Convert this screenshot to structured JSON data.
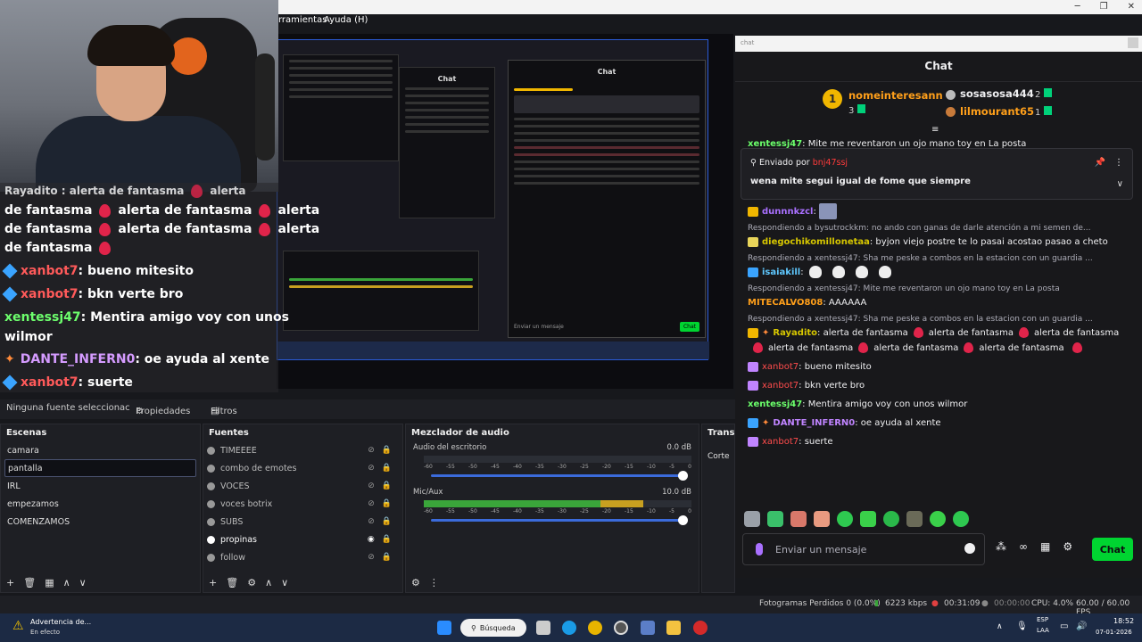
{
  "menu": {
    "herramientas": "rramientas",
    "ayuda": "Ayuda (H)"
  },
  "overlay": {
    "lines": [
      {
        "name": "",
        "text": "de fantasma",
        "text2": "alerta de fantasma",
        "text3": "alerta"
      },
      {
        "name": "",
        "text": "de fantasma",
        "text2": "alerta de fantasma",
        "text3": "alerta"
      },
      {
        "name": "",
        "text": "de fantasma"
      }
    ],
    "top_partial": "Rayadito : alerta de fantasma",
    "top_partial_tail": "alerta",
    "msg1_user": "xanbot7",
    "msg1_text": ": bueno mitesito",
    "msg2_user": "xanbot7",
    "msg2_text": ": bkn verte bro",
    "msg3_user": "xentessj47",
    "msg3_text": ": Mentira amigo voy con unos",
    "msg3_text2": "wilmor",
    "msg4_user": "DANTE_INFERN0",
    "msg4_text": ": oe ayuda al xente",
    "msg5_user": "xanbot7",
    "msg5_text": ": suerte"
  },
  "preview_mini": {
    "chat_title": "Chat",
    "send_placeholder": "Enviar un mensaje",
    "chat_btn": "Chat"
  },
  "props_bar": {
    "no_source": "Ninguna fuente seleccionac",
    "properties": "Propiedades",
    "filters": "Filtros"
  },
  "scenes": {
    "title": "Escenas",
    "items": [
      "camara",
      "pantalla",
      "IRL",
      "empezamos",
      "COMENZAMOS"
    ],
    "selected": "pantalla"
  },
  "sources": {
    "title": "Fuentes",
    "items": [
      "TIMEEEE",
      "combo de emotes",
      "VOCES",
      "voces botrix",
      "SUBS",
      "propinas",
      "follow"
    ]
  },
  "mixer": {
    "title": "Mezclador de audio",
    "tracks": [
      {
        "name": "Audio del escritorio",
        "db": "0.0 dB",
        "level": 0.0
      },
      {
        "name": "Mic/Aux",
        "db": "10.0 dB",
        "level": 0.82
      }
    ],
    "scale": [
      "-60",
      "-55",
      "-50",
      "-45",
      "-40",
      "-35",
      "-30",
      "-25",
      "-20",
      "-15",
      "-10",
      "-5",
      "0"
    ]
  },
  "transitions": {
    "title": "Transici",
    "mode": "Corte"
  },
  "status": {
    "dropped": "Fotogramas Perdidos 0 (0.0%)",
    "kbps": "6223 kbps",
    "live": "00:31:09",
    "rec": "00:00:00",
    "cpu": "CPU: 4.0%",
    "fps": "60.00 / 60.00 FPS"
  },
  "taskbar": {
    "warning_title": "Advertencia de...",
    "warning_sub": "En efecto",
    "search": "Búsqueda",
    "lang1": "ESP",
    "lang2": "LAA",
    "time": "18:52",
    "date": "07-01-2026"
  },
  "chatwin": {
    "window_title": "chat",
    "header": "Chat",
    "leader1_name": "nomeinteresann",
    "leader1_rank": "1",
    "leader1_count": "3",
    "leader2_name": "sosasosa444",
    "leader2_count": "2",
    "leader3_name": "lilmourant65",
    "leader3_count": "1",
    "cut_user": "xentessj47",
    "cut_text": ": Mite me reventaron un ojo mano toy en La posta",
    "pinned_by_label": "Enviado por",
    "pinned_by_user": "bnj47ssj",
    "pinned_msg": "wena mite segui igual de fome que siempre",
    "msgs": {
      "m1_user": "dunnnkzcl",
      "m1_text": ":",
      "r2": "Respondiendo a bysutrockkm: no ando con ganas de darle atención a mi semen de...",
      "m2_user": "diegochikomillonetaa",
      "m2_text": ": byjon viejo postre te lo pasai acostao pasao a cheto",
      "r3": "Respondiendo a xentessj47: Sha me peske a combos en la estacion con un guardia ...",
      "m3_user": "isaiakill",
      "m3_text": ":",
      "r4": "Respondiendo a xentessj47: Mite me reventaron un ojo mano toy en La posta",
      "m4_user": "MITECALVO808",
      "m4_text": ": AAAAAA",
      "r5": "Respondiendo a xentessj47: Sha me peske a combos en la estacion con un guardia ...",
      "m5_user": "Rayadito",
      "m5_text_a": ": alerta de fantasma",
      "m5_text_b": "alerta de fantasma",
      "m5_text_c": "alerta de",
      "m5_text_d": "fantasma",
      "m5_text_e": "alerta de fantasma",
      "m5_text_f": "alerta de fantasma",
      "m5_text_g": "alerta de fantasma",
      "m6_user": "xanbot7",
      "m6_text": ": bueno mitesito",
      "m7_user": "xanbot7",
      "m7_text": ": bkn verte bro",
      "m8_user": "xentessj47",
      "m8_text": ": Mentira amigo voy con unos wilmor",
      "m9_user": "DANTE_INFERN0",
      "m9_text": ": oe ayuda al xente",
      "m10_user": "xanbot7",
      "m10_text": ": suerte"
    },
    "input_placeholder": "Enviar un mensaje",
    "chat_button": "Chat"
  },
  "colors": {
    "accent_green": "#00d431",
    "twitch_purple": "#a970ff",
    "name_red": "#ff4c4c"
  }
}
